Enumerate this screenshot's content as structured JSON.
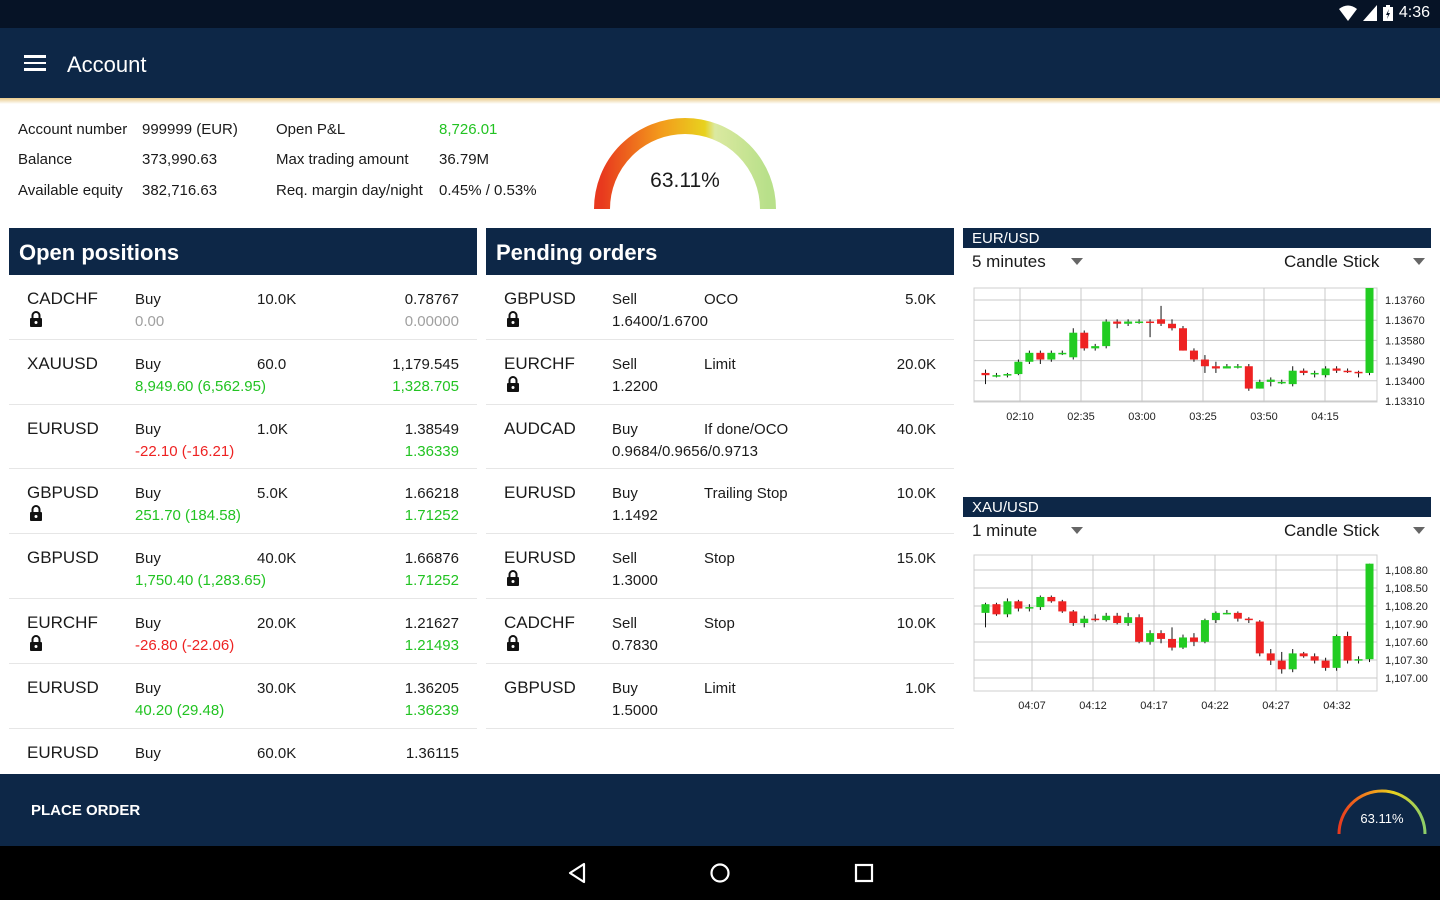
{
  "status_bar": {
    "time": "4:36"
  },
  "app_bar": {
    "title": "Account"
  },
  "summary": {
    "account_number_label": "Account number",
    "account_number_value": "999999 (EUR)",
    "balance_label": "Balance",
    "balance_value": "373,990.63",
    "available_equity_label": "Available equity",
    "available_equity_value": "382,716.63",
    "open_pl_label": "Open P&L",
    "open_pl_value": "8,726.01",
    "max_trading_label": "Max trading amount",
    "max_trading_value": "36.79M",
    "req_margin_label": "Req. margin day/night",
    "req_margin_value": "0.45% / 0.53%"
  },
  "gauge": {
    "value_text": "63.11%",
    "level_percent": 63.11
  },
  "open_positions": {
    "title": "Open positions",
    "rows": [
      {
        "symbol": "CADCHF",
        "locked": true,
        "side": "Buy",
        "pl": "0.00",
        "pl_color": "grey",
        "amount": "10.0K",
        "open_rate": "0.78767",
        "current_rate": "0.00000",
        "rate_color": "grey"
      },
      {
        "symbol": "XAUUSD",
        "locked": false,
        "side": "Buy",
        "pl": "8,949.60 (6,562.95)",
        "pl_color": "green",
        "amount": "60.0",
        "open_rate": "1,179.545",
        "current_rate": "1,328.705",
        "rate_color": "green"
      },
      {
        "symbol": "EURUSD",
        "locked": false,
        "side": "Buy",
        "pl": "-22.10 (-16.21)",
        "pl_color": "red",
        "amount": "1.0K",
        "open_rate": "1.38549",
        "current_rate": "1.36339",
        "rate_color": "green"
      },
      {
        "symbol": "GBPUSD",
        "locked": true,
        "side": "Buy",
        "pl": "251.70 (184.58)",
        "pl_color": "green",
        "amount": "5.0K",
        "open_rate": "1.66218",
        "current_rate": "1.71252",
        "rate_color": "green"
      },
      {
        "symbol": "GBPUSD",
        "locked": false,
        "side": "Buy",
        "pl": "1,750.40 (1,283.65)",
        "pl_color": "green",
        "amount": "40.0K",
        "open_rate": "1.66876",
        "current_rate": "1.71252",
        "rate_color": "green"
      },
      {
        "symbol": "EURCHF",
        "locked": true,
        "side": "Buy",
        "pl": "-26.80 (-22.06)",
        "pl_color": "red",
        "amount": "20.0K",
        "open_rate": "1.21627",
        "current_rate": "1.21493",
        "rate_color": "green"
      },
      {
        "symbol": "EURUSD",
        "locked": false,
        "side": "Buy",
        "pl": "40.20 (29.48)",
        "pl_color": "green",
        "amount": "30.0K",
        "open_rate": "1.36205",
        "current_rate": "1.36239",
        "rate_color": "green"
      },
      {
        "symbol": "EURUSD",
        "locked": false,
        "side": "Buy",
        "pl": "",
        "pl_color": "green",
        "amount": "60.0K",
        "open_rate": "1.36115",
        "current_rate": "",
        "rate_color": "green"
      }
    ]
  },
  "pending_orders": {
    "title": "Pending orders",
    "rows": [
      {
        "symbol": "GBPUSD",
        "locked": true,
        "side": "Sell",
        "rate": "1.6400/1.6700",
        "type": "OCO",
        "amount": "5.0K"
      },
      {
        "symbol": "EURCHF",
        "locked": true,
        "side": "Sell",
        "rate": "1.2200",
        "type": "Limit",
        "amount": "20.0K"
      },
      {
        "symbol": "AUDCAD",
        "locked": false,
        "side": "Buy",
        "rate": "0.9684/0.9656/0.9713",
        "type": "If done/OCO",
        "amount": "40.0K"
      },
      {
        "symbol": "EURUSD",
        "locked": false,
        "side": "Buy",
        "rate": "1.1492",
        "type": "Trailing Stop",
        "amount": "10.0K"
      },
      {
        "symbol": "EURUSD",
        "locked": true,
        "side": "Sell",
        "rate": "1.3000",
        "type": "Stop",
        "amount": "15.0K"
      },
      {
        "symbol": "CADCHF",
        "locked": true,
        "side": "Sell",
        "rate": "0.7830",
        "type": "Stop",
        "amount": "10.0K"
      },
      {
        "symbol": "GBPUSD",
        "locked": false,
        "side": "Buy",
        "rate": "1.5000",
        "type": "Limit",
        "amount": "1.0K"
      }
    ]
  },
  "charts_ui": [
    {
      "title": "EUR/USD",
      "timeframe": "5 minutes",
      "chart_type": "Candle Stick"
    },
    {
      "title": "XAU/USD",
      "timeframe": "1 minute",
      "chart_type": "Candle Stick"
    }
  ],
  "chart_data": [
    {
      "type": "candlestick",
      "title": "EUR/USD",
      "x_tick_labels": [
        "02:10",
        "02:35",
        "03:00",
        "03:25",
        "03:50",
        "04:15"
      ],
      "y_tick_labels": [
        "1.13760",
        "1.13670",
        "1.13580",
        "1.13490",
        "1.13400",
        "1.13310"
      ],
      "ylim": [
        1.1327,
        1.1378
      ],
      "up_color": "#22cc22",
      "down_color": "#ee2222",
      "candles": [
        [
          1.134,
          1.13415,
          1.1335,
          1.1339
        ],
        [
          1.1339,
          1.134,
          1.1338,
          1.1339
        ],
        [
          1.1339,
          1.134,
          1.1338,
          1.13395
        ],
        [
          1.13395,
          1.1346,
          1.1339,
          1.1345
        ],
        [
          1.1345,
          1.135,
          1.1344,
          1.1349
        ],
        [
          1.1349,
          1.135,
          1.1344,
          1.1346
        ],
        [
          1.1346,
          1.135,
          1.1345,
          1.1349
        ],
        [
          1.1349,
          1.135,
          1.1348,
          1.1349
        ],
        [
          1.1347,
          1.136,
          1.1346,
          1.1358
        ],
        [
          1.1358,
          1.1359,
          1.135,
          1.1351
        ],
        [
          1.1351,
          1.1353,
          1.135,
          1.1352
        ],
        [
          1.1352,
          1.1364,
          1.1351,
          1.1363
        ],
        [
          1.1363,
          1.1364,
          1.136,
          1.1362
        ],
        [
          1.1362,
          1.1364,
          1.1361,
          1.1363
        ],
        [
          1.1363,
          1.1364,
          1.1362,
          1.1363
        ],
        [
          1.1363,
          1.1364,
          1.1356,
          1.13625
        ],
        [
          1.1364,
          1.137,
          1.1361,
          1.1362
        ],
        [
          1.1362,
          1.1364,
          1.1359,
          1.136
        ],
        [
          1.136,
          1.1361,
          1.135,
          1.135
        ],
        [
          1.135,
          1.1351,
          1.1345,
          1.1346
        ],
        [
          1.1346,
          1.1348,
          1.134,
          1.1343
        ],
        [
          1.1343,
          1.1345,
          1.134,
          1.1342
        ],
        [
          1.1342,
          1.1344,
          1.1342,
          1.1343
        ],
        [
          1.1343,
          1.1344,
          1.1342,
          1.1343
        ],
        [
          1.1343,
          1.1344,
          1.1332,
          1.1333
        ],
        [
          1.1333,
          1.1337,
          1.1333,
          1.1336
        ],
        [
          1.1336,
          1.1338,
          1.1334,
          1.1337
        ],
        [
          1.1336,
          1.1337,
          1.1335,
          1.1336
        ],
        [
          1.1335,
          1.1343,
          1.1334,
          1.1341
        ],
        [
          1.1341,
          1.1342,
          1.1339,
          1.134
        ],
        [
          1.134,
          1.1341,
          1.1338,
          1.134
        ],
        [
          1.1339,
          1.1343,
          1.1338,
          1.1342
        ],
        [
          1.1342,
          1.1343,
          1.134,
          1.1341
        ],
        [
          1.1341,
          1.1342,
          1.134,
          1.13405
        ],
        [
          1.13405,
          1.1341,
          1.1338,
          1.134
        ],
        [
          1.134,
          1.1378,
          1.1339,
          1.1378
        ]
      ]
    },
    {
      "type": "candlestick",
      "title": "XAU/USD",
      "x_tick_labels": [
        "04:07",
        "04:12",
        "04:17",
        "04:22",
        "04:27",
        "04:32"
      ],
      "y_tick_labels": [
        "1,108.80",
        "1,108.50",
        "1,108.20",
        "1,107.90",
        "1,107.60",
        "1,107.30",
        "1,107.00"
      ],
      "ylim": [
        1106.98,
        1108.86
      ],
      "up_color": "#22cc22",
      "down_color": "#ee2222",
      "candles": [
        [
          1108.06,
          1108.2,
          1107.86,
          1108.18
        ],
        [
          1108.18,
          1108.2,
          1108.02,
          1108.04
        ],
        [
          1108.04,
          1108.26,
          1108.0,
          1108.22
        ],
        [
          1108.22,
          1108.24,
          1108.08,
          1108.12
        ],
        [
          1108.12,
          1108.18,
          1108.08,
          1108.14
        ],
        [
          1108.14,
          1108.3,
          1108.1,
          1108.28
        ],
        [
          1108.28,
          1108.3,
          1108.2,
          1108.22
        ],
        [
          1108.22,
          1108.24,
          1108.06,
          1108.08
        ],
        [
          1108.08,
          1108.1,
          1107.88,
          1107.92
        ],
        [
          1107.92,
          1108.02,
          1107.86,
          1107.98
        ],
        [
          1107.98,
          1108.04,
          1107.94,
          1107.96
        ],
        [
          1107.96,
          1108.06,
          1107.94,
          1108.02
        ],
        [
          1108.02,
          1108.06,
          1107.9,
          1107.92
        ],
        [
          1107.92,
          1108.06,
          1107.88,
          1108.0
        ],
        [
          1108.0,
          1108.04,
          1107.64,
          1107.66
        ],
        [
          1107.66,
          1107.82,
          1107.62,
          1107.78
        ],
        [
          1107.78,
          1107.82,
          1107.64,
          1107.7
        ],
        [
          1107.7,
          1107.86,
          1107.54,
          1107.58
        ],
        [
          1107.58,
          1107.76,
          1107.56,
          1107.72
        ],
        [
          1107.72,
          1107.78,
          1107.6,
          1107.66
        ],
        [
          1107.66,
          1107.98,
          1107.64,
          1107.96
        ],
        [
          1107.96,
          1108.08,
          1107.92,
          1108.06
        ],
        [
          1108.06,
          1108.1,
          1108.04,
          1108.06
        ],
        [
          1108.06,
          1108.08,
          1107.94,
          1107.98
        ],
        [
          1107.98,
          1108.0,
          1107.92,
          1107.96
        ],
        [
          1107.94,
          1107.96,
          1107.46,
          1107.5
        ],
        [
          1107.5,
          1107.56,
          1107.34,
          1107.4
        ],
        [
          1107.4,
          1107.52,
          1107.22,
          1107.28
        ],
        [
          1107.28,
          1107.56,
          1107.24,
          1107.5
        ],
        [
          1107.5,
          1107.52,
          1107.44,
          1107.46
        ],
        [
          1107.46,
          1107.5,
          1107.36,
          1107.4
        ],
        [
          1107.4,
          1107.44,
          1107.26,
          1107.3
        ],
        [
          1107.3,
          1107.76,
          1107.26,
          1107.74
        ],
        [
          1107.74,
          1107.8,
          1107.36,
          1107.4
        ],
        [
          1107.4,
          1107.46,
          1107.36,
          1107.42
        ],
        [
          1107.42,
          1108.74,
          1107.38,
          1108.74
        ]
      ]
    }
  ],
  "bottom_bar": {
    "place_order_label": "PLACE ORDER",
    "mini_gauge_text": "63.11%"
  },
  "colors": {
    "header": "#0d2747",
    "status": "#061326",
    "green": "#22c322",
    "red": "#ee2222",
    "grey": "#a0a0a0"
  }
}
